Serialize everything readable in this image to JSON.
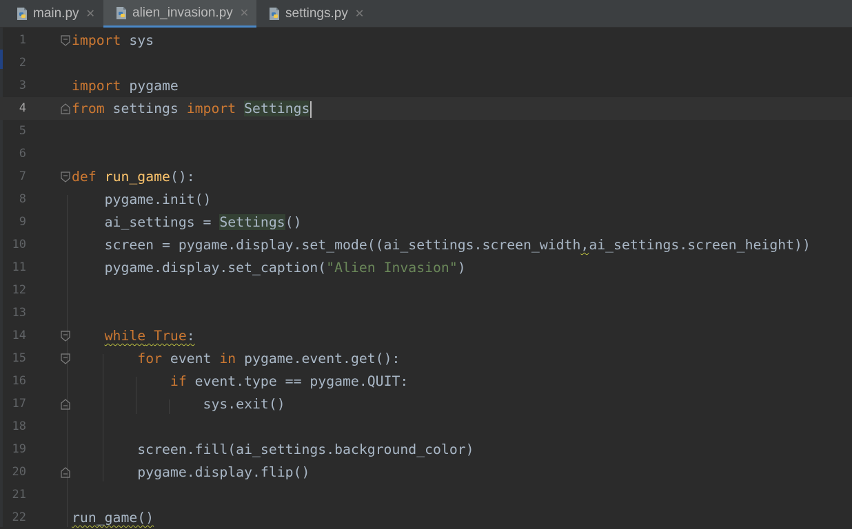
{
  "tabs": [
    {
      "label": "main.py",
      "icon": "python-file-icon",
      "active": false
    },
    {
      "label": "alien_invasion.py",
      "icon": "python-file-icon",
      "active": true
    },
    {
      "label": "settings.py",
      "icon": "python-file-icon",
      "active": false
    }
  ],
  "tab_close_glyph": "✕",
  "editor": {
    "current_line": 4,
    "line_numbers": [
      "1",
      "2",
      "3",
      "4",
      "5",
      "6",
      "7",
      "8",
      "9",
      "10",
      "11",
      "12",
      "13",
      "14",
      "15",
      "16",
      "17",
      "18",
      "19",
      "20",
      "21",
      "22"
    ],
    "tokens": {
      "l1_kw": "import",
      "l1_rest": " sys",
      "l3_kw": "import",
      "l3_rest": " pygame",
      "l4_kw1": "from",
      "l4_mid": " settings ",
      "l4_kw2": "import",
      "l4_sp": " ",
      "l4_cls": "Settings",
      "l7_kw": "def",
      "l7_sp": " ",
      "l7_fn": "run_game",
      "l7_rest": "():",
      "l8": "    pygame.init()",
      "l9_a": "    ai_settings = ",
      "l9_cls": "Settings",
      "l9_b": "()",
      "l10_a": "    screen = pygame.display.set_mode((ai_settings.screen_width",
      "l10_comma": ",",
      "l10_b": "ai_settings.screen_height))",
      "l11_a": "    pygame.display.set_caption(",
      "l11_str": "\"Alien Invasion\"",
      "l11_b": ")",
      "l14_ind": "    ",
      "l14_kw1": "while",
      "l14_sp": " ",
      "l14_kw2": "True",
      "l14_colon": ":",
      "l15_ind": "        ",
      "l15_kw1": "for",
      "l15_mid": " event ",
      "l15_kw2": "in",
      "l15_rest": " pygame.event.get():",
      "l16_ind": "            ",
      "l16_kw": "if",
      "l16_rest": " event.type == pygame.QUIT:",
      "l17": "                sys.exit()",
      "l19": "        screen.fill(ai_settings.background_color)",
      "l20": "        pygame.display.flip()",
      "l22": "run_game()"
    }
  },
  "colors": {
    "background": "#2b2b2b",
    "keyword": "#cc7832",
    "function": "#ffc66d",
    "string": "#6a8759",
    "text": "#a9b7c6",
    "tab_accent": "#4a88c7"
  }
}
